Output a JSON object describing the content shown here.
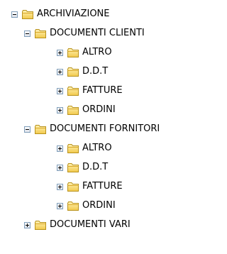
{
  "tree": {
    "root": {
      "label": "ARCHIVIAZIONE",
      "toggle": "minus",
      "icon": "folder-icon"
    },
    "clienti": {
      "label": "DOCUMENTI CLIENTI",
      "toggle": "minus",
      "children": [
        {
          "label": "ALTRO",
          "toggle": "plus"
        },
        {
          "label": "D.D.T",
          "toggle": "plus"
        },
        {
          "label": "FATTURE",
          "toggle": "plus"
        },
        {
          "label": "ORDINI",
          "toggle": "plus"
        }
      ]
    },
    "fornitori": {
      "label": "DOCUMENTI FORNITORI",
      "toggle": "minus",
      "children": [
        {
          "label": "ALTRO",
          "toggle": "plus"
        },
        {
          "label": "D.D.T",
          "toggle": "plus"
        },
        {
          "label": "FATTURE",
          "toggle": "plus"
        },
        {
          "label": "ORDINI",
          "toggle": "plus"
        }
      ]
    },
    "vari": {
      "label": "DOCUMENTI VARI",
      "toggle": "plus"
    }
  },
  "colors": {
    "folder_fill": "#f6d56a",
    "folder_stroke": "#b8921c",
    "toggle_border": "#7f9db9"
  }
}
